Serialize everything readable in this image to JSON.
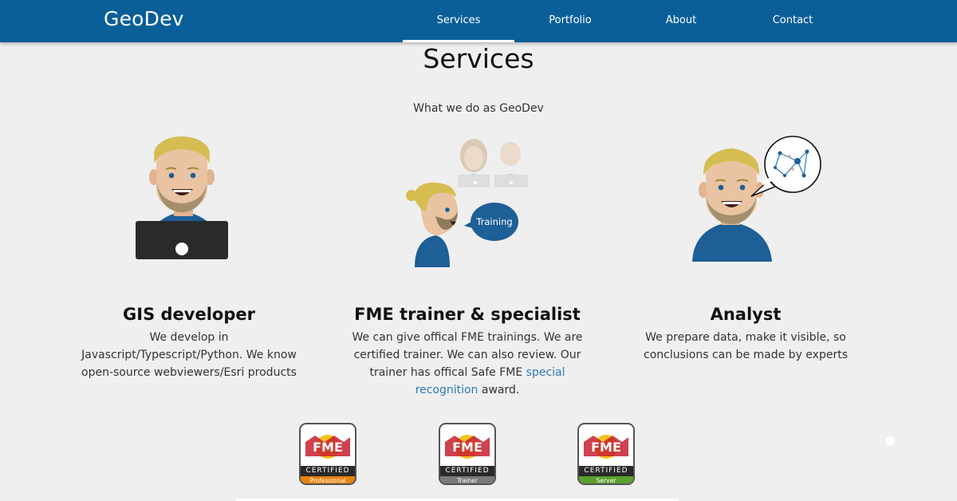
{
  "navbar": {
    "brand": "GeoDev",
    "items": [
      {
        "label": "Services",
        "active": true
      },
      {
        "label": "Portfolio",
        "active": false
      },
      {
        "label": "About",
        "active": false
      },
      {
        "label": "Contact",
        "active": false
      }
    ]
  },
  "page": {
    "title": "Services",
    "subtitle": "What we do as GeoDev"
  },
  "illustrations": {
    "training_bubble": "Training"
  },
  "services": [
    {
      "title": "GIS developer",
      "description": "We develop in Javascript/Typescript/Python. We know open-source webviewers/Esri products"
    },
    {
      "title": "FME trainer & specialist",
      "description_before": "We can give offical FME trainings. We are certified trainer. We can also review. Our trainer has offical Safe FME ",
      "link_text": "special recognition",
      "description_after": " award."
    },
    {
      "title": "Analyst",
      "description": "We prepare data, make it visible, so conclusions can be made by experts"
    }
  ],
  "badges": [
    {
      "logo": "FME",
      "certified": "CERTIFIED",
      "level": "Professional",
      "color": "#e8820c"
    },
    {
      "logo": "FME",
      "certified": "CERTIFIED",
      "level": "Trainer",
      "color": "#7a7a7a"
    },
    {
      "logo": "FME",
      "certified": "CERTIFIED",
      "level": "Server",
      "color": "#5aa02c"
    }
  ],
  "colors": {
    "navbar": "#0a5f99",
    "accent_blue": "#1d5f96",
    "link": "#2b7bb9",
    "background": "#efefef"
  }
}
